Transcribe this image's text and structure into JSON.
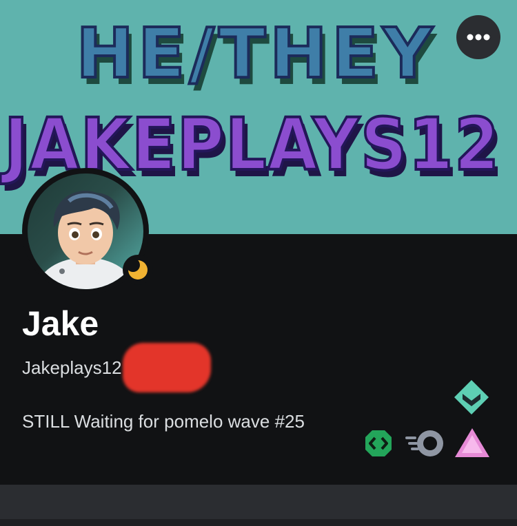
{
  "banner": {
    "line1": "HE/THEY",
    "line2": "JAKEPLAYS12",
    "background_color": "#5fb3ad",
    "line1_color": "#3f7ea8",
    "line2_color": "#8b4dcf"
  },
  "more_button": {
    "icon": "more-horizontal-icon"
  },
  "profile": {
    "display_name": "Jake",
    "username": "Jakeplays12",
    "custom_status": "STILL Waiting for pomelo wave #25",
    "status_icon": "idle-moon-icon",
    "status_color": "#f0b232"
  },
  "badges": [
    {
      "icon": "hypesquad-bravery-icon"
    },
    {
      "icon": "active-developer-icon"
    },
    {
      "icon": "nitro-icon"
    },
    {
      "icon": "nitro-boost-icon"
    }
  ]
}
